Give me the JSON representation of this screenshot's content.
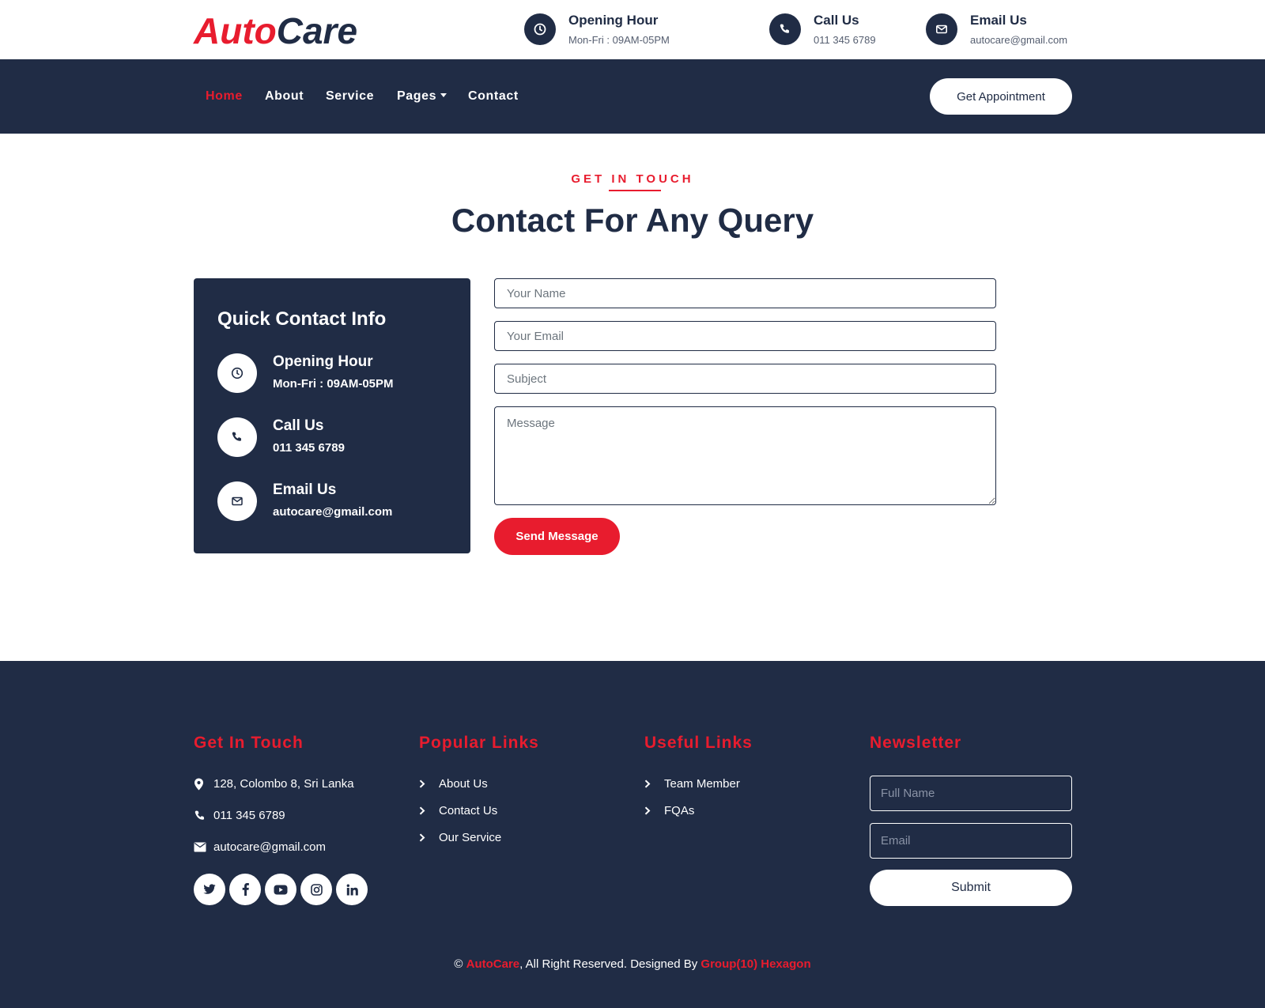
{
  "brand": {
    "part1": "Auto",
    "part2": "Care",
    "primary_color": "#e81c2e",
    "dark_color": "#202c45"
  },
  "topbar": {
    "items": [
      {
        "icon": "clock-icon",
        "title": "Opening Hour",
        "value": "Mon-Fri : 09AM-05PM"
      },
      {
        "icon": "phone-icon",
        "title": "Call Us",
        "value": "011 345 6789"
      },
      {
        "icon": "envelope-icon",
        "title": "Email Us",
        "value": "autocare@gmail.com"
      }
    ]
  },
  "nav": {
    "items": [
      "Home",
      "About",
      "Service",
      "Pages",
      "Contact"
    ],
    "active": "Home",
    "cta": "Get Appointment"
  },
  "contact": {
    "eyebrow": "GET IN TOUCH",
    "heading": "Contact For Any Query",
    "card": {
      "title": "Quick Contact Info",
      "items": [
        {
          "icon": "clock-icon",
          "title": "Opening Hour",
          "value": "Mon-Fri : 09AM-05PM"
        },
        {
          "icon": "phone-icon",
          "title": "Call Us",
          "value": "011 345 6789"
        },
        {
          "icon": "envelope-icon",
          "title": "Email Us",
          "value": "autocare@gmail.com"
        }
      ]
    },
    "form": {
      "name_placeholder": "Your Name",
      "email_placeholder": "Your Email",
      "subject_placeholder": "Subject",
      "message_placeholder": "Message",
      "submit": "Send Message"
    }
  },
  "footer": {
    "get_in_touch": {
      "heading": "Get In Touch",
      "address": "128, Colombo 8, Sri Lanka",
      "phone": "011 345 6789",
      "email": "autocare@gmail.com",
      "socials": [
        "twitter-icon",
        "facebook-icon",
        "youtube-icon",
        "instagram-icon",
        "linkedin-icon"
      ]
    },
    "popular_links": {
      "heading": "Popular Links",
      "items": [
        "About Us",
        "Contact Us",
        "Our Service"
      ]
    },
    "useful_links": {
      "heading": "Useful Links",
      "items": [
        "Team Member",
        "FQAs"
      ]
    },
    "newsletter": {
      "heading": "Newsletter",
      "name_placeholder": "Full Name",
      "email_placeholder": "Email",
      "submit": "Submit"
    },
    "copyright": {
      "symbol": "©",
      "brand": "AutoCare",
      "text": ", All Right Reserved. Designed By ",
      "designer": "Group(10) Hexagon"
    }
  }
}
